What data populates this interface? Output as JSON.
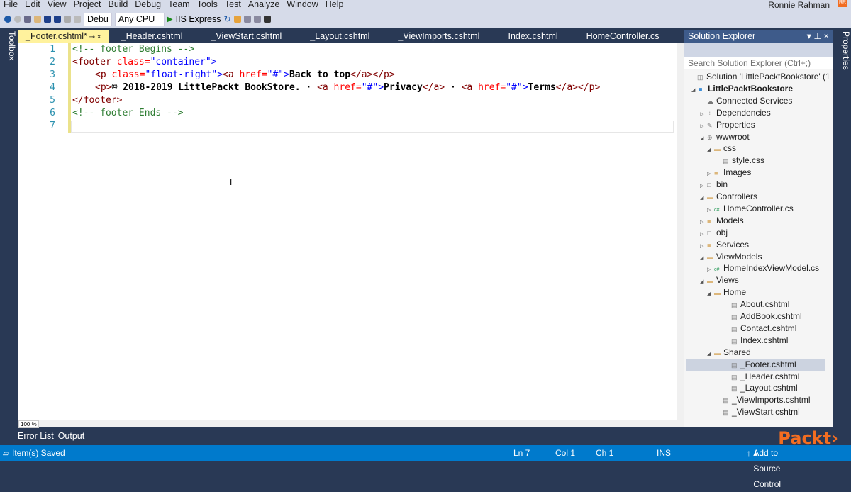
{
  "menu": [
    "File",
    "Edit",
    "View",
    "Project",
    "Build",
    "Debug",
    "Team",
    "Tools",
    "Test",
    "Analyze",
    "Window",
    "Help"
  ],
  "user": {
    "name": "Ronnie Rahman",
    "initials": "RR"
  },
  "toolbar": {
    "config": "Debu",
    "platform": "Any CPU",
    "run": "IIS Express"
  },
  "tabs": [
    "_Footer.cshtml*",
    "_Header.cshtml",
    "_ViewStart.cshtml",
    "_Layout.cshtml",
    "_ViewImports.cshtml",
    "Index.cshtml",
    "HomeController.cs"
  ],
  "side": {
    "toolbox": "Toolbox",
    "properties": "Properties"
  },
  "editor": {
    "lines": [
      "1",
      "2",
      "3",
      "4",
      "5",
      "6",
      "7"
    ],
    "zoom": "100 %",
    "l1": "<!-- footer Begins -->",
    "l6": "<!-- footer Ends -->",
    "tokens": {
      "footer_open": "<footer",
      "class_attr": " class=",
      "container": "\"container\"",
      "gt": ">",
      "p_open": "<p",
      "float": "\"float-right\"",
      "a_open": "<a",
      "href": " href=",
      "hash": "\"#\"",
      "back": "Back to top",
      "a_close": "</a>",
      "p_close": "</p>",
      "p_plain": "<p>",
      "copy": "© 2018-2019 LittlePackt BookStore. · ",
      "privacy": "Privacy",
      "dot": " · ",
      "terms": "Terms",
      "footer_close": "</footer>"
    }
  },
  "solution_explorer": {
    "title": "Solution Explorer",
    "search_placeholder": "Search Solution Explorer (Ctrl+;)",
    "items": [
      {
        "label": "Solution 'LittlePacktBookstore' (1",
        "level": 0,
        "arrow": "",
        "icon": "solution-icon"
      },
      {
        "label": "LittlePacktBookstore",
        "level": 1,
        "arrow": "expanded",
        "icon": "project-icon",
        "bold": true
      },
      {
        "label": "Connected Services",
        "level": 2,
        "arrow": "",
        "icon": "cloud-icon"
      },
      {
        "label": "Dependencies",
        "level": 2,
        "arrow": "collapsed",
        "icon": "dependencies-icon"
      },
      {
        "label": "Properties",
        "level": 2,
        "arrow": "collapsed",
        "icon": "wrench-icon"
      },
      {
        "label": "wwwroot",
        "level": 2,
        "arrow": "expanded",
        "icon": "globe-icon"
      },
      {
        "label": "css",
        "level": 3,
        "arrow": "expanded",
        "icon": "folder-open-icon"
      },
      {
        "label": "style.css",
        "level": 4,
        "arrow": "",
        "icon": "file-icon"
      },
      {
        "label": "Images",
        "level": 3,
        "arrow": "collapsed",
        "icon": "folder-icon"
      },
      {
        "label": "bin",
        "level": 2,
        "arrow": "collapsed",
        "icon": "folder-empty-icon"
      },
      {
        "label": "Controllers",
        "level": 2,
        "arrow": "expanded",
        "icon": "folder-open-icon"
      },
      {
        "label": "HomeController.cs",
        "level": 3,
        "arrow": "collapsed",
        "icon": "csharp-icon"
      },
      {
        "label": "Models",
        "level": 2,
        "arrow": "collapsed",
        "icon": "folder-icon"
      },
      {
        "label": "obj",
        "level": 2,
        "arrow": "collapsed",
        "icon": "folder-empty-icon"
      },
      {
        "label": "Services",
        "level": 2,
        "arrow": "collapsed",
        "icon": "folder-icon"
      },
      {
        "label": "ViewModels",
        "level": 2,
        "arrow": "expanded",
        "icon": "folder-open-icon"
      },
      {
        "label": "HomeIndexViewModel.cs",
        "level": 3,
        "arrow": "collapsed",
        "icon": "csharp-icon"
      },
      {
        "label": "Views",
        "level": 2,
        "arrow": "expanded",
        "icon": "folder-open-icon"
      },
      {
        "label": "Home",
        "level": 3,
        "arrow": "expanded",
        "icon": "folder-open-icon"
      },
      {
        "label": "About.cshtml",
        "level": 5,
        "arrow": "",
        "icon": "file-icon"
      },
      {
        "label": "AddBook.cshtml",
        "level": 5,
        "arrow": "",
        "icon": "file-icon"
      },
      {
        "label": "Contact.cshtml",
        "level": 5,
        "arrow": "",
        "icon": "file-icon"
      },
      {
        "label": "Index.cshtml",
        "level": 5,
        "arrow": "",
        "icon": "file-icon"
      },
      {
        "label": "Shared",
        "level": 3,
        "arrow": "expanded",
        "icon": "folder-open-icon"
      },
      {
        "label": "_Footer.cshtml",
        "level": 5,
        "arrow": "",
        "icon": "file-icon",
        "selected": true
      },
      {
        "label": "_Header.cshtml",
        "level": 5,
        "arrow": "",
        "icon": "file-icon"
      },
      {
        "label": "_Layout.cshtml",
        "level": 5,
        "arrow": "",
        "icon": "file-icon"
      },
      {
        "label": "_ViewImports.cshtml",
        "level": 4,
        "arrow": "",
        "icon": "file-icon"
      },
      {
        "label": "_ViewStart.cshtml",
        "level": 4,
        "arrow": "",
        "icon": "file-icon"
      }
    ]
  },
  "bottom_tabs": [
    "Error List",
    "Output"
  ],
  "status": {
    "message": "Item(s) Saved",
    "ln": "Ln 7",
    "col": "Col 1",
    "ch": "Ch 1",
    "mode": "INS",
    "source_control": "Add to Source Control"
  },
  "watermark": "Packt>",
  "colors": {
    "accent": "#007acc",
    "frame": "#293955",
    "active_tab": "#fff29d",
    "line_numbers": "#2b91af"
  }
}
